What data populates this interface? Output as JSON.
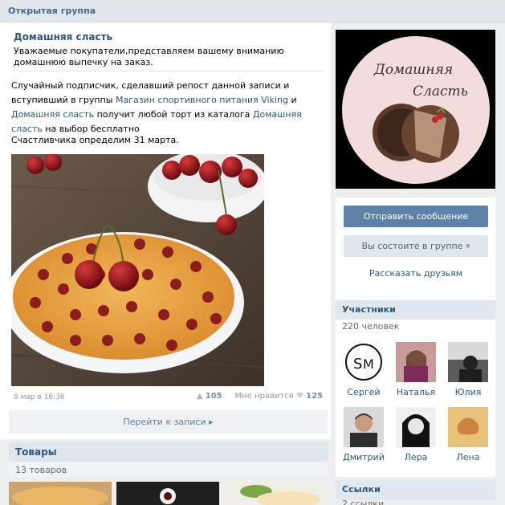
{
  "topbar": {
    "title": "Открытая группа"
  },
  "pinned": {
    "title": "Домашняя сласть",
    "description": "Уважаемые покупатели,представляем вашему вниманию домашнюю выпечку на заказ."
  },
  "post": {
    "text_1": "Случайный подписчик, сделавший репост данной записи и вступивший в группы ",
    "link_1": "Магазин спортивного питания Viking",
    "text_2": " и ",
    "link_2": "Домашняя сласть",
    "text_3": " получит любой торт из каталога ",
    "link_3": "Домашняя сласть",
    "text_4": " на выбор бесплатно",
    "announce": "Счастливчика определим 31 марта.",
    "meta_date": "8 мар в 16:36",
    "reposts": "105",
    "likes_label": "Мне нравится",
    "likes": "125",
    "goto_label": "Перейти к записи"
  },
  "goods": {
    "title": "Товары",
    "count": "13 товаров"
  },
  "sidebar": {
    "cover_logo_line1": "Домашняя",
    "cover_logo_line2": "Сласть",
    "send_message": "Отправить сообщение",
    "in_group": "Вы состоите в группе",
    "tell_friends": "Рассказать друзьям"
  },
  "members": {
    "title": "Участники",
    "count": "220 человек",
    "list": [
      {
        "name": "Сергей",
        "avatar": "sm-logo"
      },
      {
        "name": "Наталья",
        "avatar": "photo"
      },
      {
        "name": "Юлия",
        "avatar": "photo"
      },
      {
        "name": "Дмитрий",
        "avatar": "photo"
      },
      {
        "name": "Лера",
        "avatar": "photo"
      },
      {
        "name": "Лена",
        "avatar": "photo"
      }
    ]
  },
  "links": {
    "title": "Ссылки",
    "count": "2 ссылки"
  },
  "colors": {
    "accent": "#5e81a8",
    "link": "#2b587a",
    "header": "#e1e7ee"
  },
  "icons": {
    "repost": "megaphone-icon",
    "like": "heart-icon",
    "dropdown": "chevron-down-icon",
    "goto": "chevron-right-icon"
  }
}
